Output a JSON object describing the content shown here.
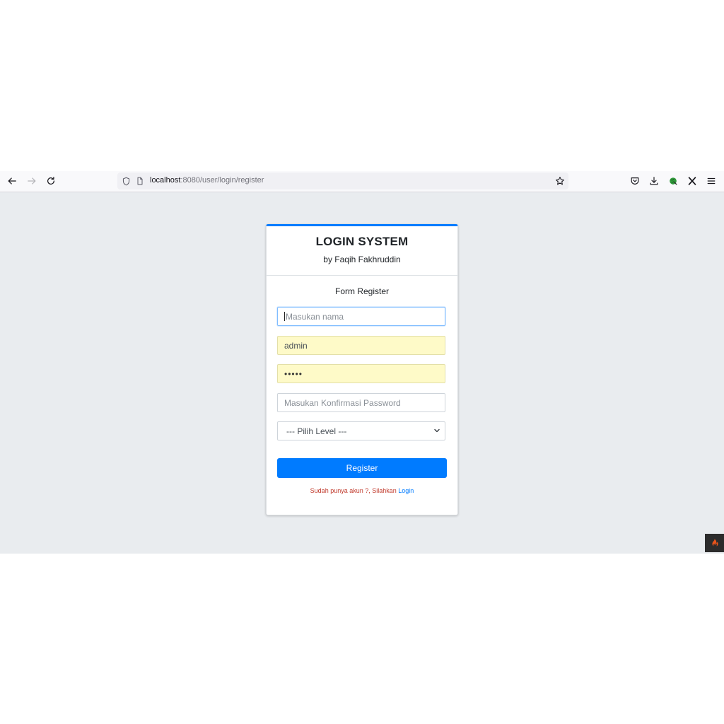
{
  "browser": {
    "url_host": "localhost",
    "url_rest": ":8080/user/login/register"
  },
  "card": {
    "title": "LOGIN SYSTEM",
    "subtitle": "by Faqih Fakhruddin",
    "form_caption": "Form Register"
  },
  "form": {
    "name_placeholder": "Masukan nama",
    "username_value": "admin",
    "password_value": "•••••",
    "confirm_placeholder": "Masukan Konfirmasi Password",
    "level_selected": "--- Pilih Level ---",
    "register_label": "Register",
    "footer_prefix": "Sudah punya akun ?, Silahkan",
    "footer_link": "Login"
  },
  "colors": {
    "accent": "#007bff",
    "page_bg": "#e9ecef",
    "autofill_bg": "#fefac8",
    "footer_text": "#c0392b"
  },
  "icons": {
    "back": "back-arrow-icon",
    "forward": "forward-arrow-icon",
    "reload": "reload-icon",
    "shield": "tracking-shield-icon",
    "page": "page-icon",
    "star": "bookmark-star-icon",
    "pocket": "pocket-icon",
    "download": "download-icon",
    "extension": "extension-globe-icon",
    "x": "x-extension-icon",
    "menu": "hamburger-menu-icon",
    "ci": "codeigniter-flame-icon"
  }
}
